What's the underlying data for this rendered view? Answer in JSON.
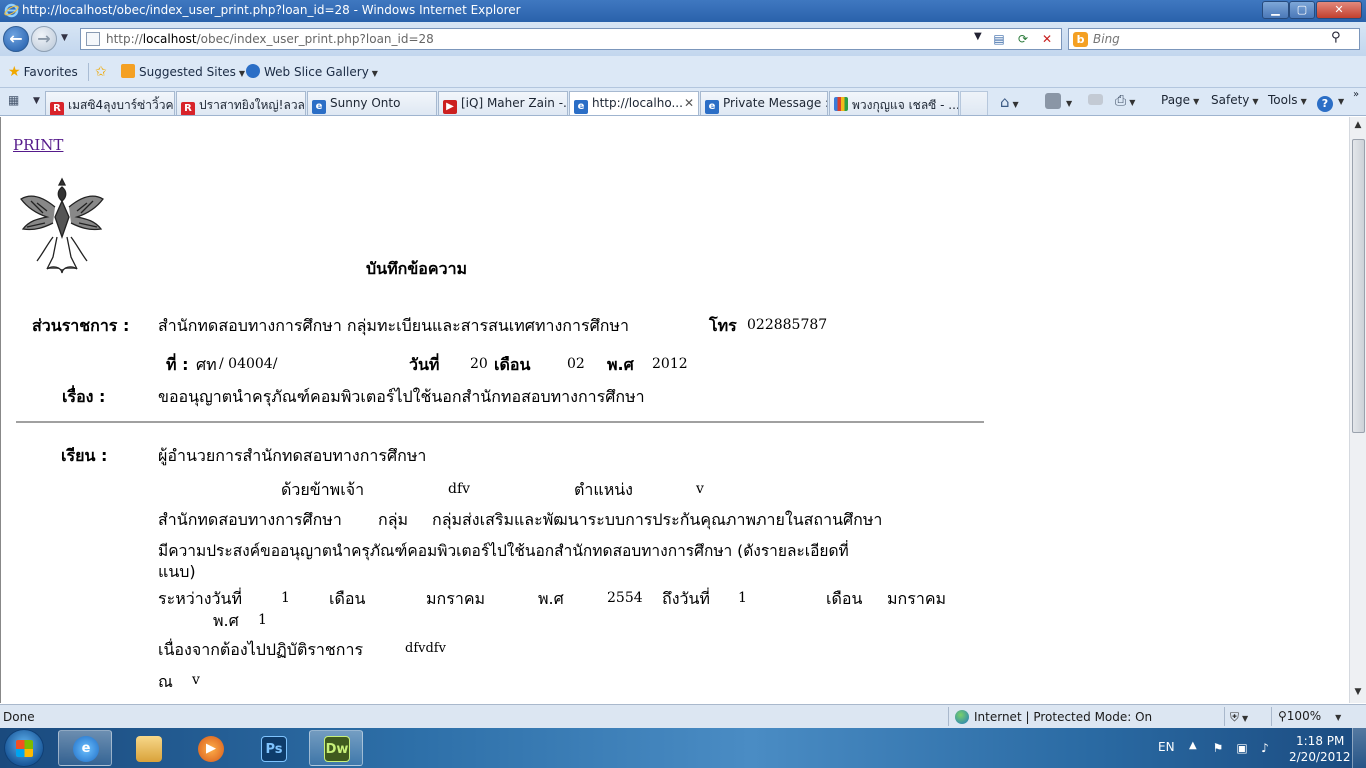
{
  "window": {
    "title": "http://localhost/obec/index_user_print.php?loan_id=28 - Windows Internet Explorer",
    "minimize_icon": "minimize-icon",
    "maximize_icon": "maximize-icon",
    "close_icon": "close-icon"
  },
  "address": {
    "prefix": "http://",
    "host": "localhost",
    "path": "/obec/index_user_print.php?loan_id=28"
  },
  "search": {
    "placeholder": "Bing"
  },
  "favorites": {
    "label": "Favorites",
    "suggested_sites": "Suggested Sites",
    "web_slice_gallery": "Web Slice Gallery"
  },
  "tabs": [
    {
      "label": "เมสซิ4ลุงบาร์ซ่าวิ้วค...",
      "icon": "r-icon",
      "active": false
    },
    {
      "label": "ปราสาทยิงใหญ่!ลวล...",
      "icon": "r-icon",
      "active": false
    },
    {
      "label": "Sunny Onto",
      "icon": "ie-icon",
      "active": false
    },
    {
      "label": "[iQ] Maher Zain -...",
      "icon": "youtube-icon",
      "active": false
    },
    {
      "label": "http://localho...",
      "icon": "ie-icon",
      "active": true
    },
    {
      "label": "Private Message :...",
      "icon": "ie-icon",
      "active": false
    },
    {
      "label": "พวงกุญแจ เชลซี - ...",
      "icon": "google-icon",
      "active": false
    }
  ],
  "command_bar": {
    "page": "Page",
    "safety": "Safety",
    "tools": "Tools"
  },
  "document": {
    "print_link": "PRINT",
    "heading": "บันทึกข้อความ",
    "agency_label": "ส่วนราชการ :",
    "agency_value": "สำนักทดสอบทางการศึกษา กลุ่มทะเบียนและสารสนเทศทางการศึกษา",
    "phone_label": "โทร",
    "phone_value": "022885787",
    "ref_label": "ที่ :",
    "ref_prefix": "ศท",
    "ref_value": "/ 04004/",
    "date_label": "วันที่",
    "day": "20",
    "month_label": "เดือน",
    "month": "02",
    "year_label": "พ.ศ",
    "year": "2012",
    "subject_label": "เรื่อง :",
    "subject_value": "ขออนุญาตนำครุภัณฑ์คอมพิวเตอร์ไปใช้นอกสำนักทอสอบทางการศึกษา",
    "to_label": "เรียน :",
    "to_value": "ผู้อำนวยการสำนักทดสอบทางการศึกษา",
    "applicant_label": "ด้วยข้าพเจ้า",
    "applicant_value": "dfv",
    "position_label": "ตำแหน่ง",
    "position_value": "v",
    "office_line": "สำนักทดสอบทางการศึกษา",
    "group_label": "กลุ่ม",
    "group_value": "กลุ่มส่งเสริมและพัฒนาระบบการประกันคุณภาพภายในสถานศึกษา",
    "purpose_line1": "มีความประสงค์ขออนุญาตนำครุภัณฑ์คอมพิวเตอร์ไปใช้นอกสำนักทดสอบทางการศึกษา (ดังรายละเอียดที่",
    "purpose_line2": "แนบ)",
    "period_label": "ระหว่างวันที่",
    "from_day": "1",
    "from_month_label": "เดือน",
    "from_month": "มกราคม",
    "from_year_label": "พ.ศ",
    "from_year": "2554",
    "to_day_label": "ถึงวันที่",
    "to_day": "1",
    "to_month_label": "เดือน",
    "to_month": "มกราคม",
    "to_year_label": "พ.ศ",
    "to_year": "1",
    "reason_label": "เนื่องจากต้องไปปฏิบัติราชการ",
    "reason_value": "dfvdfv",
    "at_label": "ณ",
    "at_value": "v"
  },
  "status": {
    "done": "Done",
    "zone": "Internet | Protected Mode: On",
    "zoom": "100%"
  },
  "taskbar": {
    "lang": "EN",
    "time": "1:18 PM",
    "date": "2/20/2012",
    "ps_label": "Ps",
    "dw_label": "Dw"
  }
}
